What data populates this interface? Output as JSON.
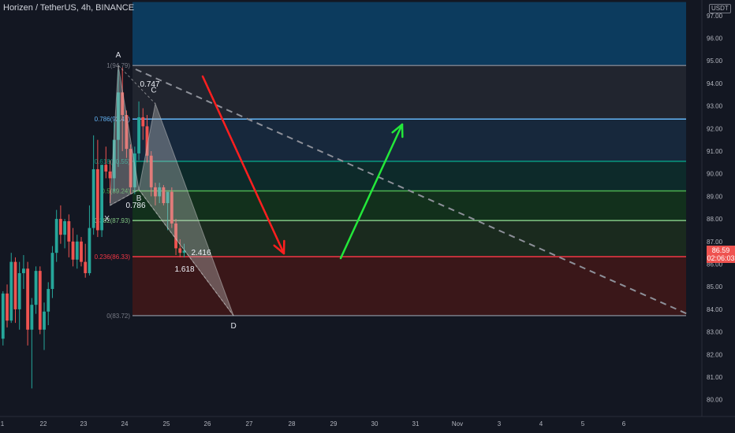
{
  "symbol": {
    "title": "Horizen / TetherUS, 4h, BINANCE",
    "currency": "USDT",
    "last_price": "86.59",
    "countdown": "02:06:03"
  },
  "colors": {
    "background": "#131722",
    "up": "#26a69a",
    "down": "#ef5350",
    "dashed_trend": "#8d9099",
    "arrow_down": "#ff1f1f",
    "arrow_up": "#23e83a",
    "pattern_fill": "#c8c8c8"
  },
  "chart_data": {
    "type": "candlestick",
    "ylim": [
      79.5,
      98.2
    ],
    "y_ticks": [
      "80.00",
      "81.00",
      "82.00",
      "83.00",
      "84.00",
      "85.00",
      "86.00",
      "87.00",
      "88.00",
      "89.00",
      "90.00",
      "91.00",
      "92.00",
      "93.00",
      "94.00",
      "95.00",
      "96.00",
      "97.00"
    ],
    "x_ticks": [
      "1",
      "22",
      "23",
      "24",
      "25",
      "26",
      "27",
      "28",
      "29",
      "30",
      "31",
      "Nov",
      "3",
      "4",
      "5",
      "6"
    ],
    "candles": [
      [
        82.7,
        84.8,
        82.4,
        84.7
      ],
      [
        84.7,
        85.1,
        83.2,
        83.5
      ],
      [
        83.5,
        86.5,
        83.4,
        86.1
      ],
      [
        86.1,
        86.3,
        83.4,
        84.0
      ],
      [
        84.0,
        86.1,
        83.1,
        85.6
      ],
      [
        85.6,
        86.4,
        84.9,
        85.8
      ],
      [
        85.8,
        86.1,
        82.4,
        83.1
      ],
      [
        83.1,
        84.5,
        80.5,
        84.2
      ],
      [
        84.2,
        85.9,
        83.8,
        85.7
      ],
      [
        85.7,
        85.9,
        82.9,
        83.1
      ],
      [
        83.1,
        84.3,
        82.2,
        83.9
      ],
      [
        83.9,
        85.2,
        83.3,
        84.9
      ],
      [
        84.9,
        86.8,
        84.5,
        86.5
      ],
      [
        86.5,
        88.4,
        86.1,
        88.0
      ],
      [
        88.0,
        88.6,
        86.9,
        87.3
      ],
      [
        87.3,
        88.0,
        86.7,
        87.9
      ],
      [
        87.9,
        88.2,
        86.3,
        87.0
      ],
      [
        87.0,
        87.6,
        85.9,
        86.2
      ],
      [
        86.2,
        87.3,
        85.8,
        87.0
      ],
      [
        87.0,
        87.2,
        85.9,
        86.1
      ],
      [
        86.1,
        86.9,
        85.4,
        85.6
      ],
      [
        85.6,
        88.6,
        85.5,
        87.6
      ],
      [
        87.6,
        91.7,
        87.3,
        90.2
      ],
      [
        90.2,
        91.5,
        87.2,
        87.5
      ],
      [
        87.5,
        90.3,
        87.2,
        90.4
      ],
      [
        90.4,
        91.2,
        89.8,
        90.1
      ],
      [
        90.1,
        90.6,
        88.7,
        89.8
      ],
      [
        89.8,
        92.3,
        89.2,
        91.5
      ],
      [
        91.5,
        94.6,
        90.3,
        93.6
      ],
      [
        93.6,
        94.7,
        91.0,
        92.6
      ],
      [
        92.6,
        92.8,
        90.7,
        91.1
      ],
      [
        91.1,
        91.3,
        89.1,
        89.4
      ],
      [
        89.4,
        91.2,
        89.1,
        90.9
      ],
      [
        90.9,
        93.2,
        90.6,
        92.5
      ],
      [
        92.5,
        92.9,
        91.5,
        92.1
      ],
      [
        92.1,
        92.6,
        90.5,
        90.8
      ],
      [
        90.8,
        91.0,
        89.0,
        89.4
      ],
      [
        89.4,
        89.6,
        88.6,
        89.0
      ],
      [
        89.0,
        89.6,
        88.7,
        89.4
      ],
      [
        89.4,
        89.5,
        88.6,
        88.7
      ],
      [
        88.7,
        89.1,
        87.5,
        89.2
      ],
      [
        89.2,
        89.4,
        87.6,
        87.8
      ],
      [
        87.8,
        88.0,
        86.4,
        86.7
      ],
      [
        86.7,
        87.1,
        86.3,
        86.5
      ],
      [
        86.5,
        86.9,
        86.3,
        86.6
      ]
    ],
    "fib_levels": [
      {
        "label": "1(94.79)",
        "value": 94.79,
        "color": "#787b86"
      },
      {
        "label": "0.786(92.42)",
        "value": 92.42,
        "color": "#64b5f6"
      },
      {
        "label": "0.618(90.55)",
        "value": 90.55,
        "color": "#089981"
      },
      {
        "label": "0.5(89.24)",
        "value": 89.24,
        "color": "#4caf50"
      },
      {
        "label": "0.382(87.93)",
        "value": 87.93,
        "color": "#81c784"
      },
      {
        "label": "0.236(86.33)",
        "value": 86.33,
        "color": "#f23645"
      },
      {
        "label": "0(83.72)",
        "value": 83.72,
        "color": "#787b86"
      }
    ],
    "fib_zones": [
      {
        "from": 94.79,
        "to": 97.6,
        "color": "#0c3b5e"
      },
      {
        "from": 92.42,
        "to": 94.79,
        "color": "#21252f"
      },
      {
        "from": 90.55,
        "to": 92.42,
        "color": "#17283c"
      },
      {
        "from": 89.24,
        "to": 90.55,
        "color": "#0d2a2a"
      },
      {
        "from": 87.93,
        "to": 89.24,
        "color": "#12301c"
      },
      {
        "from": 86.33,
        "to": 87.93,
        "color": "#1a2a1e"
      },
      {
        "from": 83.72,
        "to": 86.33,
        "color": "#3a1719"
      }
    ],
    "harmonic_points": [
      {
        "name": "X",
        "bar": 26,
        "price": 88.6
      },
      {
        "name": "A",
        "bar": 28,
        "price": 94.8
      },
      {
        "name": "B",
        "bar": 33,
        "price": 89.3
      },
      {
        "name": "C",
        "bar": 37,
        "price": 93.1
      },
      {
        "name": "D",
        "bar": 56,
        "price": 83.72
      }
    ],
    "harmonic_ratios": [
      "0.747",
      "0.786",
      "2.416",
      "1.618"
    ]
  }
}
